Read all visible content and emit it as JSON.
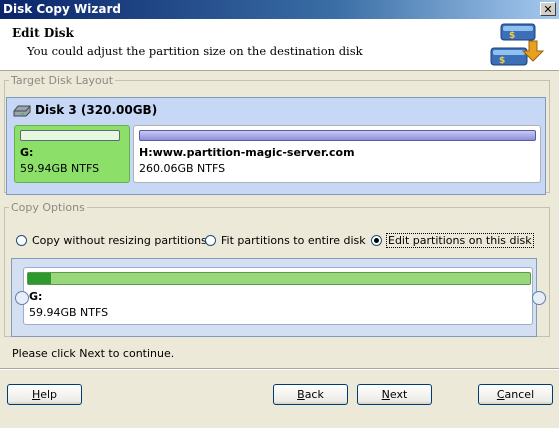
{
  "window": {
    "title": "Disk Copy Wizard",
    "close_glyph": "✕"
  },
  "header": {
    "title": "Edit Disk",
    "subtitle": "You could adjust the partition size on the destination disk",
    "icon": "disk-copy-icon"
  },
  "target_layout": {
    "legend": "Target Disk Layout",
    "disk_label": "Disk 3 (320.00GB)",
    "disk_icon": "hard-disk-icon",
    "partitions": [
      {
        "name": "G:",
        "detail": "59.94GB NTFS",
        "used_fraction": 0.0,
        "color": "#8ce06a"
      },
      {
        "name": "H:www.partition-magic-server.com",
        "detail": "260.06GB NTFS",
        "color": "#8f8fd8"
      }
    ]
  },
  "copy_options": {
    "legend": "Copy Options",
    "options": [
      {
        "label": "Copy without resizing partitions",
        "selected": false
      },
      {
        "label": "Fit partitions to entire disk",
        "selected": false
      },
      {
        "label": "Edit partitions on this disk",
        "selected": true
      }
    ],
    "edit_partition": {
      "name": "G:",
      "detail": "59.94GB NTFS",
      "used_fraction": 0.045
    }
  },
  "hint": "Please click Next to continue.",
  "buttons": {
    "help": {
      "pre": "",
      "key": "H",
      "post": "elp"
    },
    "back": {
      "pre": "",
      "key": "B",
      "post": "ack"
    },
    "next": {
      "pre": "",
      "key": "N",
      "post": "ext"
    },
    "cancel": {
      "pre": "",
      "key": "C",
      "post": "ancel"
    }
  }
}
